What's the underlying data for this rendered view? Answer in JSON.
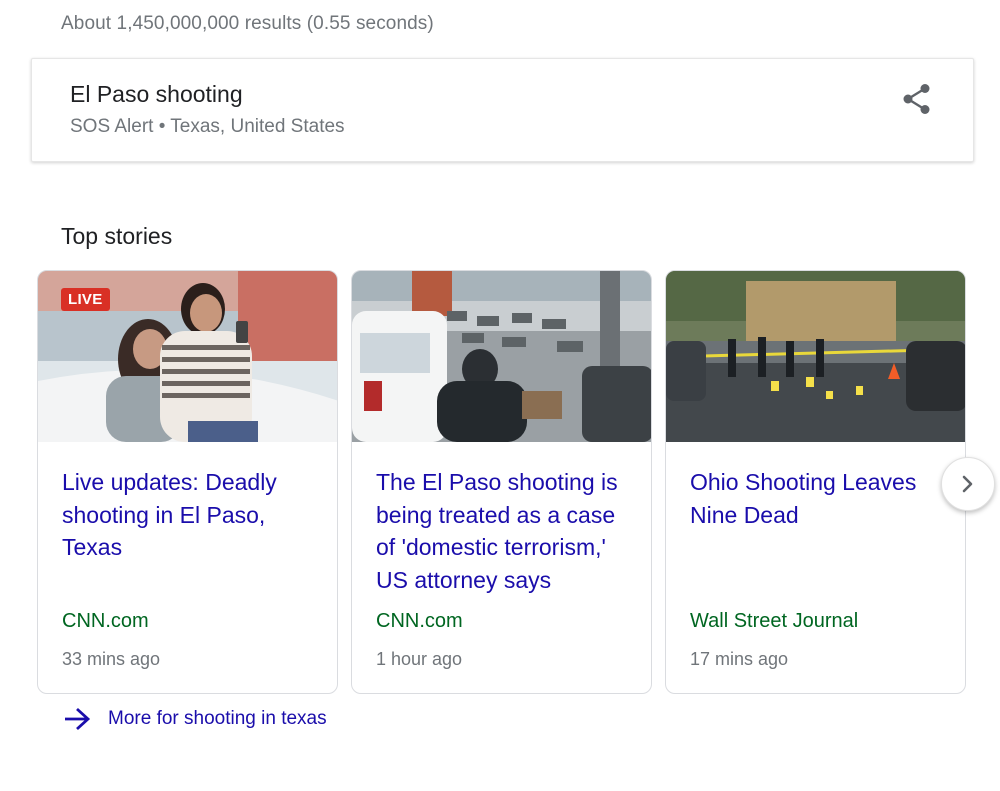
{
  "result_stats": "About 1,450,000,000 results (0.55 seconds)",
  "sos_card": {
    "title": "El Paso shooting",
    "subtitle": "SOS Alert • Texas, United States",
    "share_icon": "share-icon"
  },
  "top_stories": {
    "title": "Top stories",
    "stories": [
      {
        "badge": "LIVE",
        "headline": "Live updates: Deadly shooting in El Paso, Texas",
        "source": "CNN.com",
        "time": "33 mins ago"
      },
      {
        "headline": "The El Paso shooting is being treated as a case of 'domestic terrorism,' US attorney says",
        "source": "CNN.com",
        "time": "1 hour ago"
      },
      {
        "headline": "Ohio Shooting Leaves Nine Dead",
        "source": "Wall Street Journal",
        "time": "17 mins ago"
      }
    ],
    "next_icon": "chevron-right-icon"
  },
  "more_link": {
    "label": "More for shooting in texas",
    "icon": "arrow-right-icon"
  },
  "colors": {
    "link": "#1a0dab",
    "source": "#006621",
    "meta": "#70757a",
    "live": "#d93025"
  }
}
